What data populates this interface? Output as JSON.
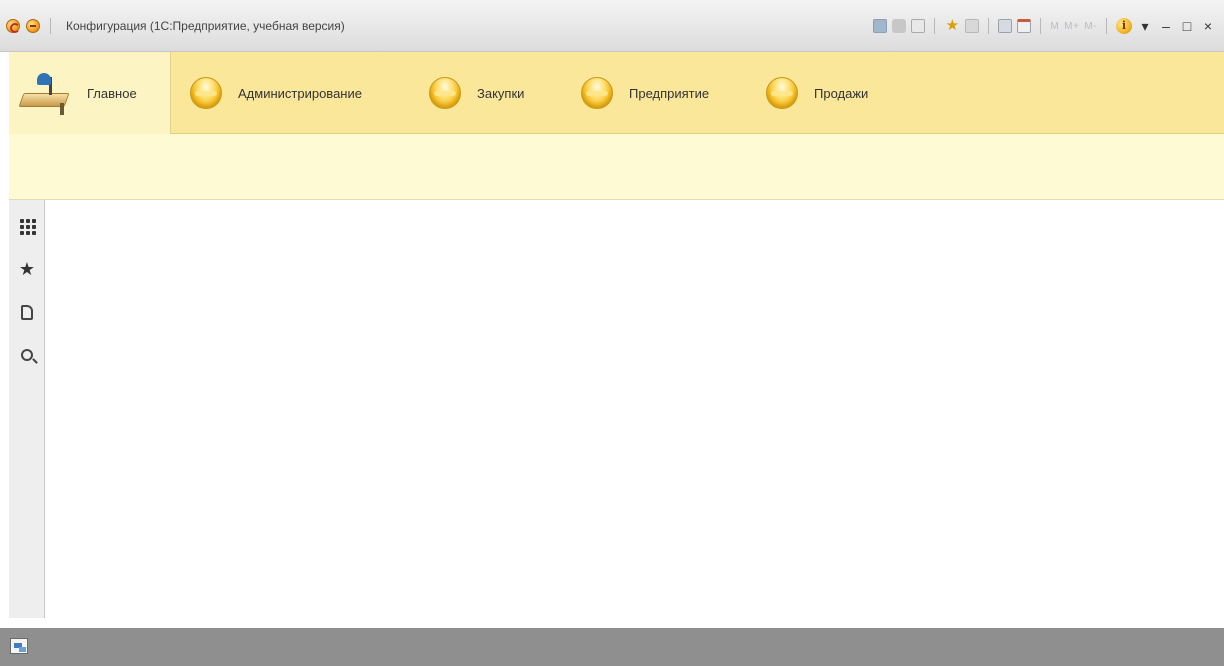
{
  "window": {
    "title": "Конфигурация  (1С:Предприятие, учебная версия)",
    "toolbar_icons": [
      "save-icon",
      "print-icon",
      "preview-icon",
      "favorites-icon",
      "history-icon",
      "calculator-icon",
      "calendar-icon"
    ],
    "memory_labels": [
      "M",
      "M+",
      "M-"
    ],
    "info_label": "i",
    "minimize_label": "–",
    "maximize_label": "□",
    "close_label": "×"
  },
  "sections": {
    "items": [
      {
        "label": "Главное",
        "active": true
      },
      {
        "label": "Администрирование"
      },
      {
        "label": "Закупки"
      },
      {
        "label": "Предприятие"
      },
      {
        "label": "Продажи"
      }
    ]
  },
  "left_panel": {
    "buttons": [
      "all-functions-icon",
      "favorites-star-icon",
      "history-icon",
      "search-icon"
    ],
    "star_glyph": "★"
  },
  "colors": {
    "sections_bg": "#fbe79a",
    "active_section_bg": "#fdf4c4",
    "band_bg": "#fefad3",
    "status_bar_bg": "#8f8f8f"
  }
}
